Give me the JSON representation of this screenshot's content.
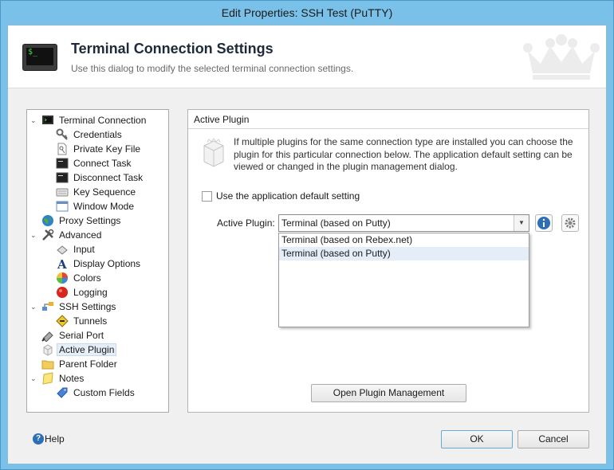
{
  "window": {
    "title": "Edit Properties: SSH Test (PuTTY)"
  },
  "header": {
    "title": "Terminal Connection Settings",
    "subtitle": "Use this dialog to modify the selected terminal connection settings.",
    "icon": "terminal-icon",
    "icon_text": "$_"
  },
  "tree": {
    "items": [
      {
        "label": "Terminal Connection",
        "icon": "terminal-icon",
        "level": 0,
        "expandable": true
      },
      {
        "label": "Credentials",
        "icon": "key-icon",
        "level": 1
      },
      {
        "label": "Private Key File",
        "icon": "key-file-icon",
        "level": 1
      },
      {
        "label": "Connect Task",
        "icon": "console-icon",
        "level": 1
      },
      {
        "label": "Disconnect Task",
        "icon": "console-icon",
        "level": 1
      },
      {
        "label": "Key Sequence",
        "icon": "keyboard-icon",
        "level": 1
      },
      {
        "label": "Window Mode",
        "icon": "window-icon",
        "level": 1
      },
      {
        "label": "Proxy Settings",
        "icon": "globe-icon",
        "level": 0
      },
      {
        "label": "Advanced",
        "icon": "tools-icon",
        "level": 0,
        "expandable": true
      },
      {
        "label": "Input",
        "icon": "input-icon",
        "level": 1
      },
      {
        "label": "Display Options",
        "icon": "font-icon",
        "level": 1
      },
      {
        "label": "Colors",
        "icon": "color-wheel-icon",
        "level": 1
      },
      {
        "label": "Logging",
        "icon": "record-icon",
        "level": 1
      },
      {
        "label": "SSH Settings",
        "icon": "network-icon",
        "level": 0,
        "expandable": true
      },
      {
        "label": "Tunnels",
        "icon": "tunnel-icon",
        "level": 1
      },
      {
        "label": "Serial Port",
        "icon": "serial-port-icon",
        "level": 0
      },
      {
        "label": "Active Plugin",
        "icon": "plugin-icon",
        "level": 0,
        "selected": true
      },
      {
        "label": "Parent Folder",
        "icon": "folder-icon",
        "level": 0
      },
      {
        "label": "Notes",
        "icon": "notes-icon",
        "level": 0,
        "expandable": true
      },
      {
        "label": "Custom Fields",
        "icon": "tag-icon",
        "level": 1
      }
    ]
  },
  "panel": {
    "title": "Active Plugin",
    "description": "If multiple plugins for the same connection type are installed you can choose the plugin for this particular connection below. The application default setting can be viewed or changed in the plugin management dialog.",
    "default_checkbox_label": "Use the application default setting",
    "default_checked": false,
    "active_plugin_label": "Active Plugin:",
    "active_plugin_value": "Terminal (based on Putty)",
    "dropdown_options": [
      "Terminal (based on Rebex.net)",
      "Terminal (based on Putty)"
    ],
    "dropdown_highlighted": 1,
    "manage_button": "Open Plugin Management"
  },
  "footer": {
    "help_label": "Help",
    "ok_label": "OK",
    "cancel_label": "Cancel"
  },
  "colors": {
    "window_frame": "#79c1e8",
    "selection": "#e6eef8",
    "info_blue": "#2c6fb8"
  }
}
